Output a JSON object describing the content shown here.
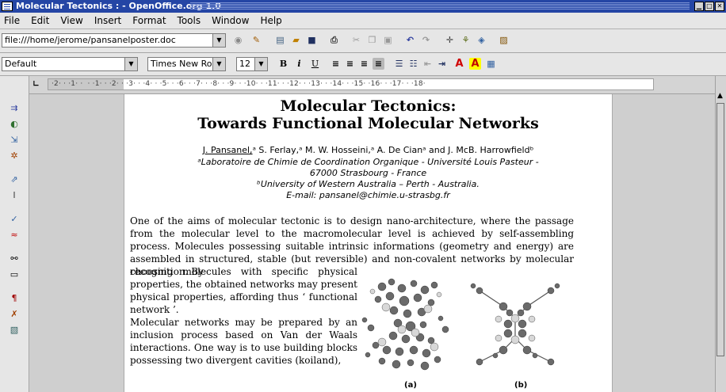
{
  "window": {
    "title": "Molecular Tectonics : - OpenOffice.org 1.0"
  },
  "menu": [
    "File",
    "Edit",
    "View",
    "Insert",
    "Format",
    "Tools",
    "Window",
    "Help"
  ],
  "toolbar": {
    "url": "file:///home/jerome/pansanelposter.doc",
    "style": "Default",
    "font": "Times New Rom",
    "size": "12",
    "bold": "B",
    "italic": "i",
    "underline": "U",
    "font_color": "A",
    "highlight": "A"
  },
  "ruler": "·2· · ·1· ·  · ·1· · ·2· · ·3· · ·4· · ·5· · ·6· · ·7· · ·8· · ·9· · ·10· · ·11· · ·12· · ·13· · ·14· · ·15· ·16· · ·17· · ·18·",
  "doc": {
    "title1": "Molecular Tectonics:",
    "title2": "Towards Functional Molecular Networks",
    "authors_name": "J. Pansanel,",
    "authors_rest": "ᵃ S. Ferlay,ᵃ M. W. Hosseini,ᵃ A. De Cianᵃ and J. McB. Harrowfieldᵇ",
    "affil1": "ᵃLaboratoire de Chimie de Coordination Organique - Université Louis Pasteur -",
    "affil2": "67000 Strasbourg - France",
    "affil3": "ᵇUniversity of Western Australia – Perth - Australia.",
    "email": "E-mail: pansanel@chimie.u-strasbg.fr",
    "para1": "One of the aims of molecular tectonic is to design nano-architecture, where the passage from the molecular level to the macromolecular level is achieved by self-assembling process. Molecules possessing suitable intrinsic informations (geometry and energy) are assembled in structured, stable (but reversible) and non-covalent networks by molecular recognition. By",
    "para2": "choosing molecules with specific physical properties, the obtained networks may present physical properties, affording thus ‘ functional network ’.",
    "para3": "Molecular networks may be prepared by an inclusion process based on Van der Waals interactions. One way is to use building blocks possessing two divergent cavities (koiland),",
    "cap_a": "(a)",
    "cap_b": "(b)"
  }
}
